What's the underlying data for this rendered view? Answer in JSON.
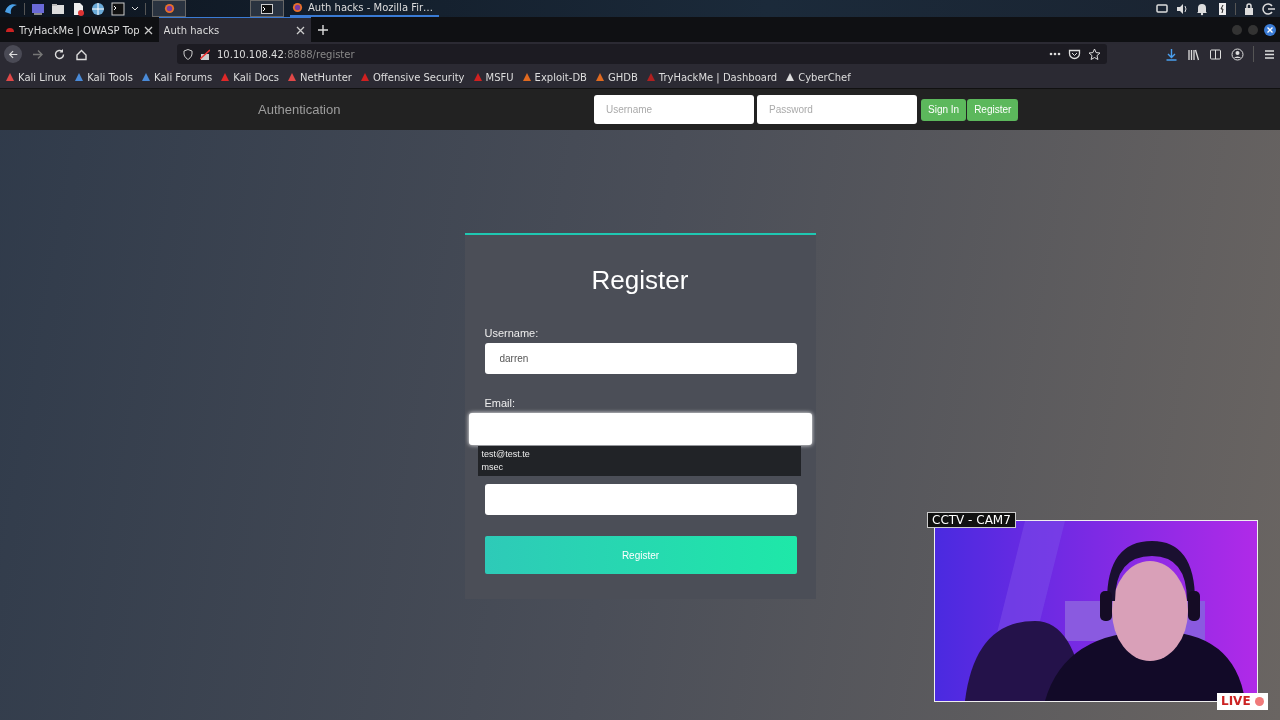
{
  "taskbar": {
    "window_title": "Auth hacks - Mozilla Fir…"
  },
  "browser": {
    "tabs": [
      {
        "label": "TryHackMe | OWASP Top",
        "selected": false
      },
      {
        "label": "Auth hacks",
        "selected": true
      }
    ],
    "url": {
      "host": "10.10.108.42",
      "path": ":8888/register"
    },
    "bookmarks": [
      {
        "label": "Kali Linux",
        "color": "#e04848"
      },
      {
        "label": "Kali Tools",
        "color": "#4a8ad8"
      },
      {
        "label": "Kali Forums",
        "color": "#4a8ad8"
      },
      {
        "label": "Kali Docs",
        "color": "#e02828"
      },
      {
        "label": "NetHunter",
        "color": "#e04848"
      },
      {
        "label": "Offensive Security",
        "color": "#d02020"
      },
      {
        "label": "MSFU",
        "color": "#d02020"
      },
      {
        "label": "Exploit-DB",
        "color": "#e06a20"
      },
      {
        "label": "GHDB",
        "color": "#e06a20"
      },
      {
        "label": "TryHackMe | Dashboard",
        "color": "#b02020"
      },
      {
        "label": "CyberChef",
        "color": "#dddddd"
      }
    ]
  },
  "site": {
    "brand": "Authentication",
    "username_placeholder": "Username",
    "password_placeholder": "Password",
    "buttons": [
      "Sign In",
      "Register"
    ]
  },
  "form": {
    "title": "Register",
    "fields": [
      {
        "kind": "text",
        "label": "Username:",
        "value": "darren",
        "focused": false
      },
      {
        "kind": "email",
        "label": "Email:",
        "focused": true
      },
      {
        "kind": "password",
        "focused": false
      }
    ],
    "autocomplete": [
      "test@test.te",
      "msec"
    ],
    "submit": "Register"
  },
  "webcam": {
    "label": "CCTV - CAM7",
    "badge": "LIVE",
    "kind": "picture"
  }
}
